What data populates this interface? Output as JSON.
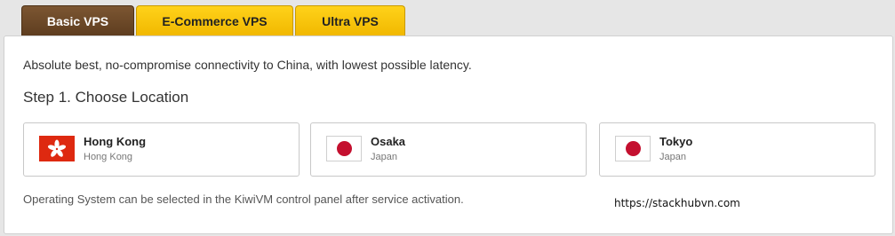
{
  "tabs": {
    "basic": "Basic VPS",
    "ecommerce": "E-Commerce VPS",
    "ultra": "Ultra VPS"
  },
  "panel": {
    "description": "Absolute best, no-compromise connectivity to China, with lowest possible latency.",
    "step_heading": "Step 1. Choose Location",
    "locations": [
      {
        "name": "Hong Kong",
        "country": "Hong Kong",
        "flag": "hong-kong-flag-icon"
      },
      {
        "name": "Osaka",
        "country": "Japan",
        "flag": "japan-flag-icon"
      },
      {
        "name": "Tokyo",
        "country": "Japan",
        "flag": "japan-flag-icon"
      }
    ],
    "os_note": "Operating System can be selected in the KiwiVM control panel after service activation."
  },
  "watermark": "https://stackhubvn.com",
  "colors": {
    "active_tab": "#6b4727",
    "inactive_tab": "#f7c600",
    "hk_red": "#de2910",
    "jp_red": "#c4102f"
  }
}
